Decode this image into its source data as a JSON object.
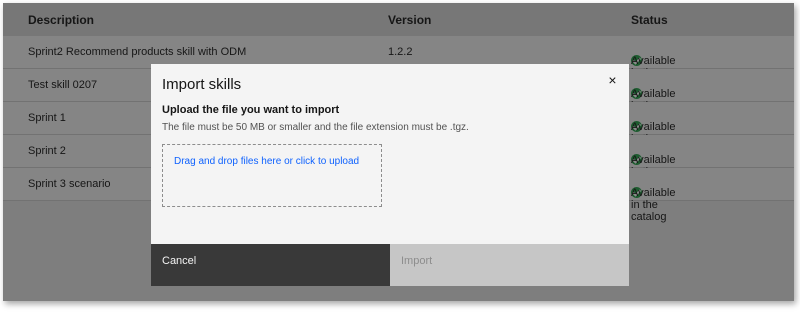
{
  "table": {
    "headers": {
      "description": "Description",
      "version": "Version",
      "status": "Status"
    },
    "rows": [
      {
        "description": "Sprint2 Recommend products skill with ODM",
        "version": "1.2.2",
        "status": "Available in the catalog"
      },
      {
        "description": "Test skill 0207",
        "version": "",
        "status": "Available in the catalog"
      },
      {
        "description": "Sprint 1",
        "version": "",
        "status": "Available in the catalog"
      },
      {
        "description": "Sprint 2",
        "version": "",
        "status": "Available in the catalog"
      },
      {
        "description": "Sprint 3 scenario",
        "version": "",
        "status": "Available in the catalog"
      }
    ]
  },
  "modal": {
    "title": "Import skills",
    "close_symbol": "×",
    "upload_label": "Upload the file you want to import",
    "upload_help": "The file must be 50 MB or smaller and the file extension must be .tgz.",
    "dropzone_text": "Drag and drop files here or click to upload",
    "cancel_label": "Cancel",
    "import_label": "Import"
  },
  "colors": {
    "status_ok": "#24a148",
    "link": "#0f62fe",
    "cancel_bg": "#393939",
    "import_disabled_bg": "#c6c6c6"
  },
  "icons": {
    "status": "checkmark-filled-icon",
    "close": "close-icon"
  }
}
